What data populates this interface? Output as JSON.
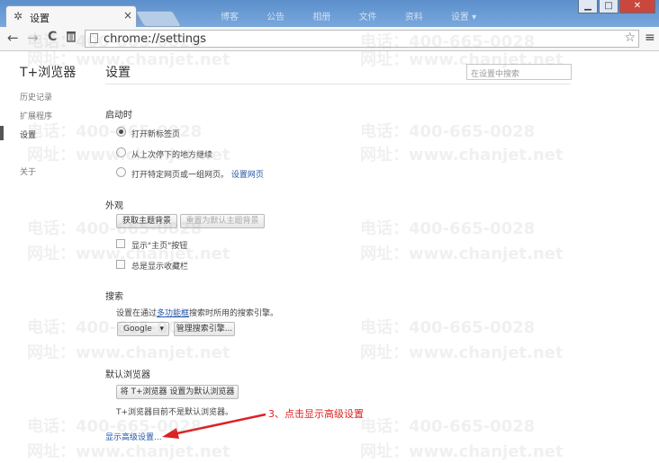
{
  "tab": {
    "title": "设置",
    "close": "×"
  },
  "background_menu": [
    "博客",
    "公告",
    "相册",
    "文件",
    "资料",
    "设置 ▾"
  ],
  "window_controls": {
    "minimize": "▁",
    "maximize": "□",
    "close": "✕"
  },
  "toolbar": {
    "back": "←",
    "forward": "→",
    "reload": "C",
    "trash": "🗑",
    "url": "chrome://settings",
    "star": "☆",
    "menu": "≡"
  },
  "sidebar": {
    "brand": "T+浏览器",
    "items": [
      {
        "label": "历史记录"
      },
      {
        "label": "扩展程序"
      },
      {
        "label": "设置"
      },
      {
        "label": "关于"
      }
    ]
  },
  "main": {
    "title": "设置",
    "search_placeholder": "在设置中搜索",
    "startup": {
      "title": "启动时",
      "options": [
        "打开新标签页",
        "从上次停下的地方继续",
        "打开特定网页或一组网页。"
      ],
      "set_pages_link": "设置网页",
      "selected_index": 0
    },
    "appearance": {
      "title": "外观",
      "get_theme": "获取主题背景",
      "reset_theme": "重置为默认主题背景",
      "checkboxes": [
        "显示\"主页\"按钮",
        "总是显示收藏栏"
      ]
    },
    "search": {
      "title": "搜索",
      "desc_before": "设置在通过",
      "desc_link": "多功能框",
      "desc_after": "搜索时所用的搜索引擎。",
      "engine": "Google",
      "manage_button": "管理搜索引擎..."
    },
    "default_browser": {
      "title": "默认浏览器",
      "set_default_button": "将 T+浏览器 设置为默认浏览器",
      "status": "T+浏览器目前不是默认浏览器。"
    },
    "advanced_link": "显示高级设置...",
    "annotation": "3、点击显示高级设置"
  },
  "watermark": {
    "phone": "电话：400-665-0028",
    "site": "网址：www.chanjet.net"
  },
  "colors": {
    "annotation": "#dd2222",
    "link": "#2255aa"
  }
}
